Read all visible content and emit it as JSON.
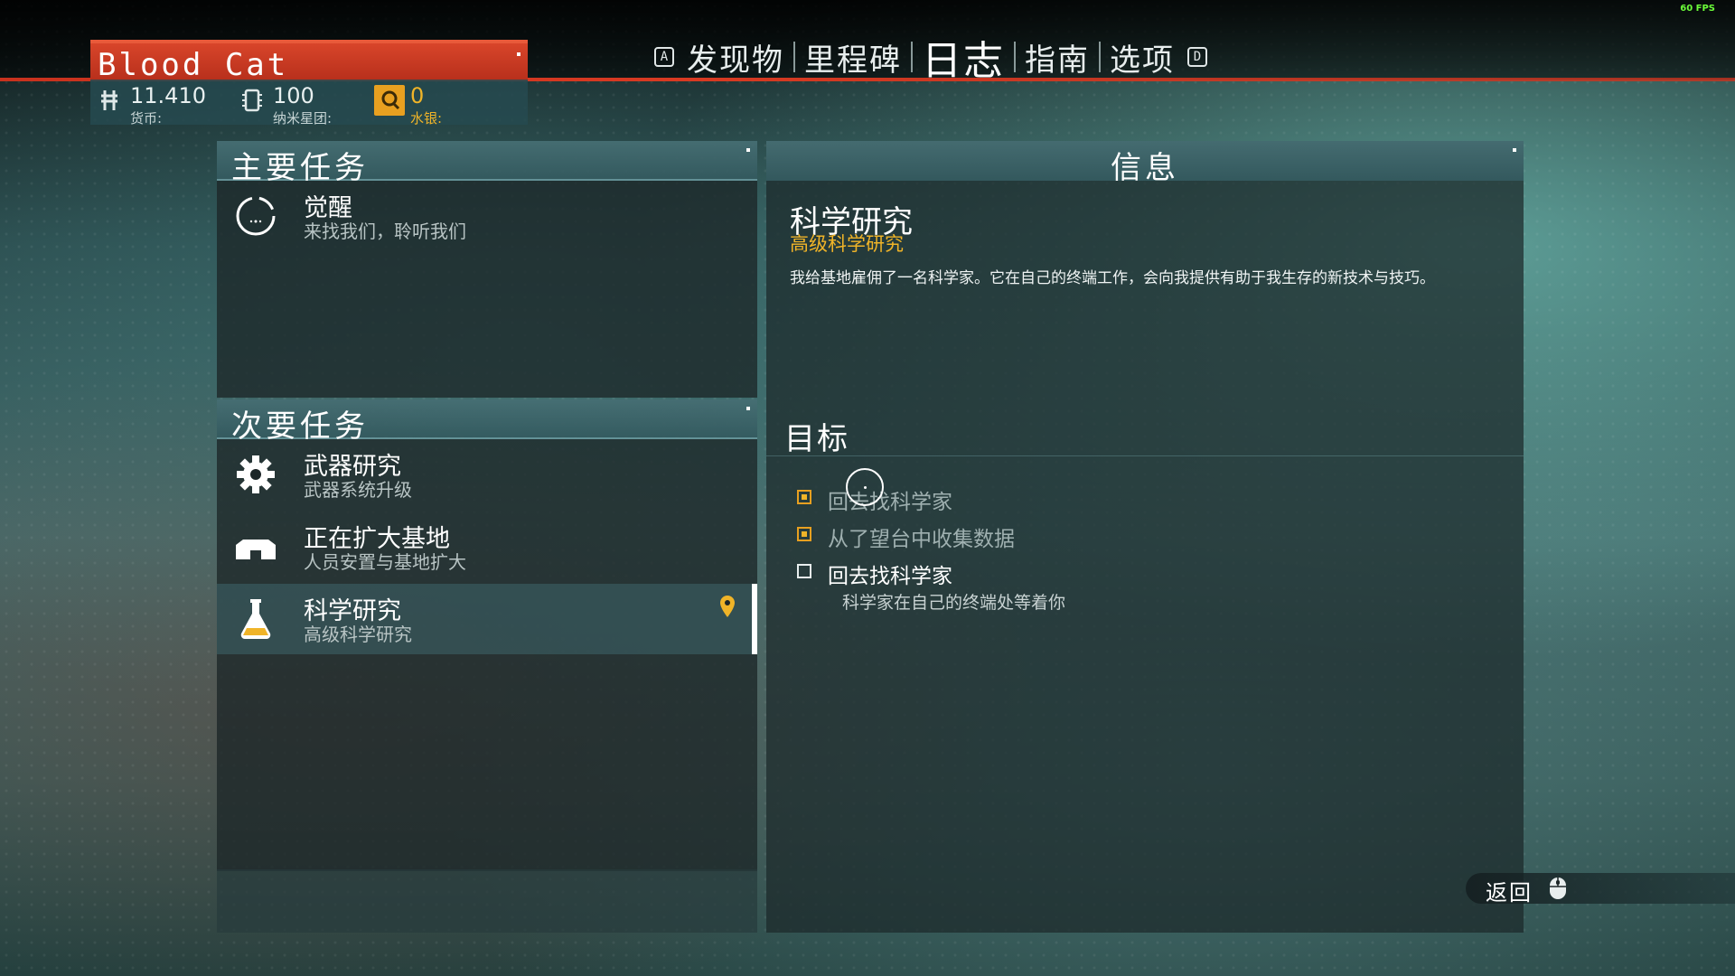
{
  "hud": {
    "fps": "60 FPS"
  },
  "player": {
    "name": "Blood Cat",
    "currency": {
      "value": "11.410",
      "label": "货币:"
    },
    "nanites": {
      "value": "100",
      "label": "纳米星团:"
    },
    "quicksilver": {
      "value": "0",
      "label": "水银:"
    }
  },
  "tabs": {
    "left_key": "A",
    "right_key": "D",
    "items": [
      {
        "label": "发现物"
      },
      {
        "label": "里程碑"
      },
      {
        "label": "日志"
      },
      {
        "label": "指南"
      },
      {
        "label": "选项"
      }
    ],
    "active_index": 2
  },
  "main_missions": {
    "title": "主要任务",
    "items": [
      {
        "title": "觉醒",
        "subtitle": "来找我们，聆听我们",
        "icon": "awakening-ring-icon"
      }
    ]
  },
  "secondary_missions": {
    "title": "次要任务",
    "items": [
      {
        "title": "武器研究",
        "subtitle": "武器系统升级",
        "icon": "gear-icon"
      },
      {
        "title": "正在扩大基地",
        "subtitle": "人员安置与基地扩大",
        "icon": "base-icon"
      },
      {
        "title": "科学研究",
        "subtitle": "高级科学研究",
        "icon": "flask-icon",
        "selected": true
      }
    ]
  },
  "info": {
    "title": "信息",
    "mission_title": "科学研究",
    "mission_subtitle": "高级科学研究",
    "description": "我给基地雇佣了一名科学家。它在自己的终端工作，会向我提供有助于我生存的新技术与技巧。",
    "objectives_title": "目标",
    "objectives": [
      {
        "text": "回去找科学家",
        "done": true
      },
      {
        "text": "从了望台中收集数据",
        "done": true
      },
      {
        "text": "回去找科学家",
        "done": false
      }
    ],
    "objective_note": "科学家在自己的终端处等着你"
  },
  "back": {
    "label": "返回"
  },
  "colors": {
    "accent_red": "#d83a22",
    "accent_gold": "#f0b428",
    "panel_teal": "#466e73"
  }
}
